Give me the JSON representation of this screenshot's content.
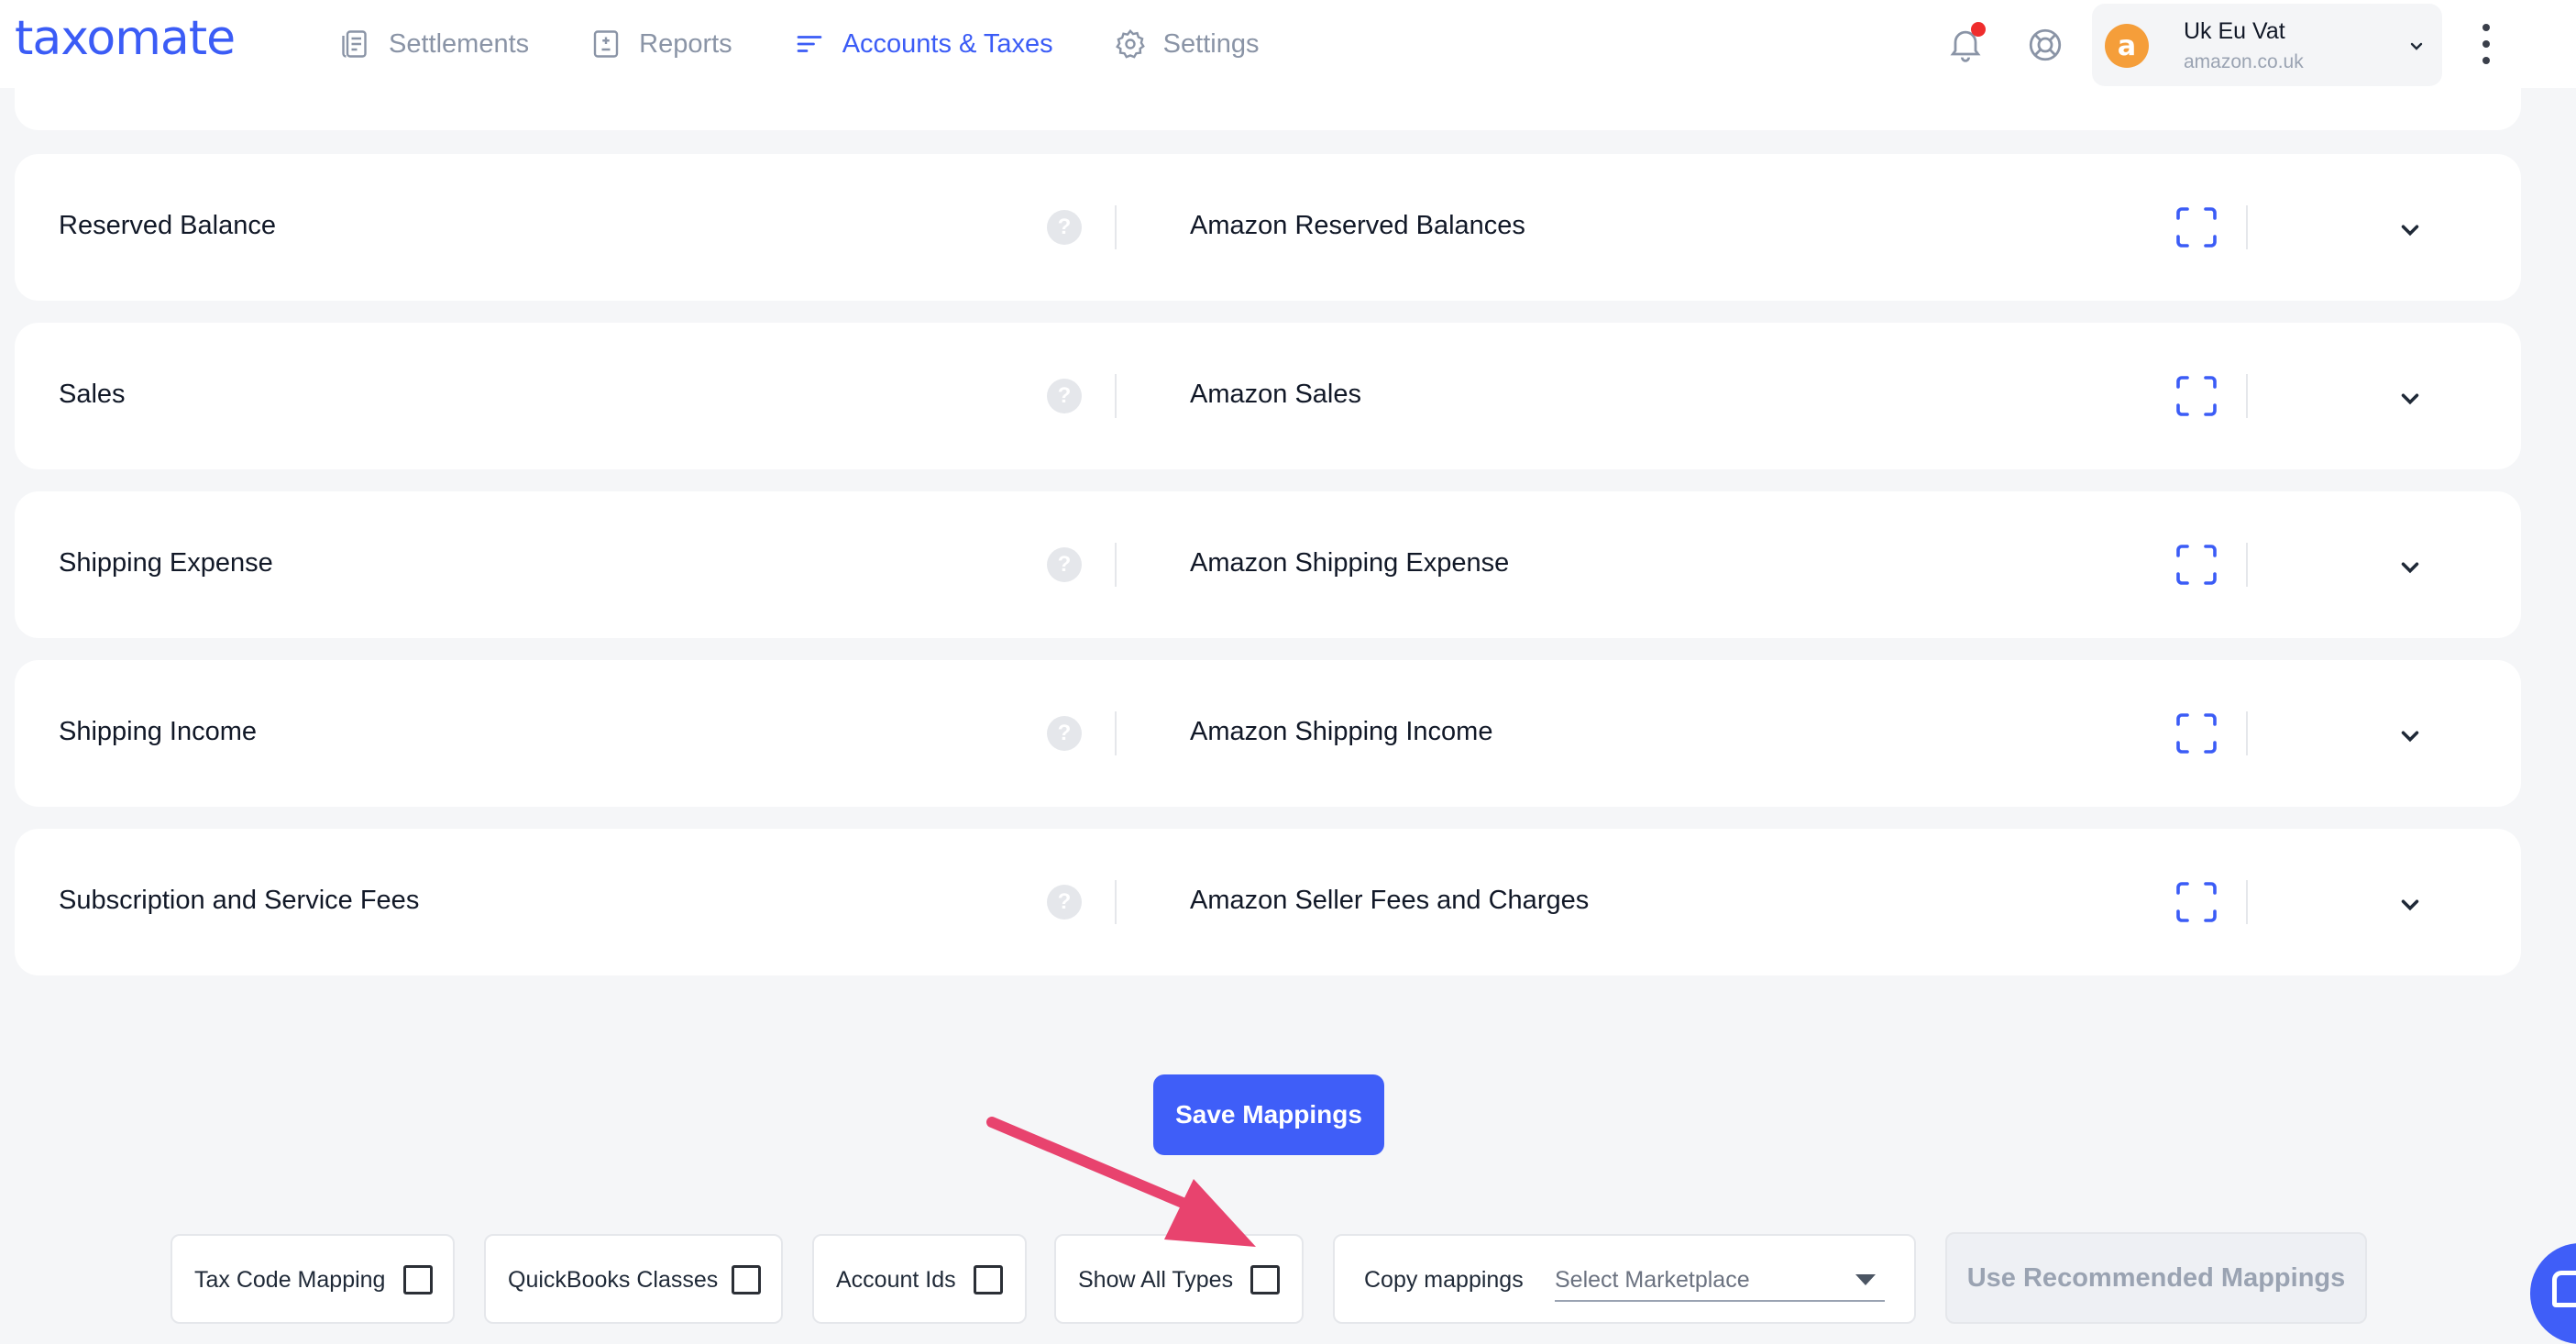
{
  "brand": {
    "logo_text": "taxomate",
    "accent": "#3b5cf6"
  },
  "nav": {
    "items": [
      {
        "label": "Settlements",
        "icon": "document-icon",
        "active": false
      },
      {
        "label": "Reports",
        "icon": "report-icon",
        "active": false
      },
      {
        "label": "Accounts & Taxes",
        "icon": "list-icon",
        "active": true
      },
      {
        "label": "Settings",
        "icon": "gear-icon",
        "active": false
      }
    ]
  },
  "account": {
    "name": "Uk Eu Vat",
    "marketplace": "amazon.co.uk",
    "badge": "a"
  },
  "mappings": [
    {
      "label": "Reserved Balance",
      "value": "Amazon Reserved Balances"
    },
    {
      "label": "Sales",
      "value": "Amazon Sales"
    },
    {
      "label": "Shipping Expense",
      "value": "Amazon Shipping Expense"
    },
    {
      "label": "Shipping Income",
      "value": "Amazon Shipping Income"
    },
    {
      "label": "Subscription and Service Fees",
      "value": "Amazon Seller Fees and Charges"
    }
  ],
  "help_glyph": "?",
  "actions": {
    "save_label": "Save Mappings",
    "use_recommended_label": "Use Recommended Mappings"
  },
  "options": {
    "tax_code_mapping": {
      "label": "Tax Code Mapping",
      "checked": false
    },
    "quickbooks_classes": {
      "label": "QuickBooks Classes",
      "checked": false
    },
    "account_ids": {
      "label": "Account Ids",
      "checked": false
    },
    "show_all_types": {
      "label": "Show All Types",
      "checked": false
    },
    "copy_mappings": {
      "label": "Copy mappings",
      "placeholder": "Select Marketplace"
    }
  },
  "colors": {
    "primary_button": "#3f5ef8",
    "annotation_arrow": "#e8436e",
    "notification_dot": "#ef2d2d"
  }
}
